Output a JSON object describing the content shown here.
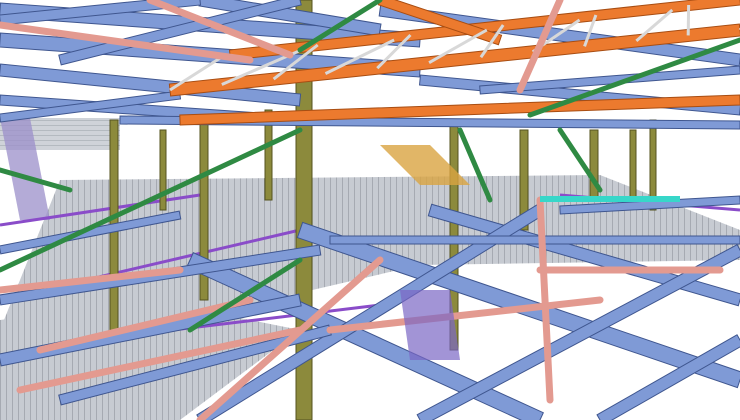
{
  "scene": {
    "subject": "structural-steel-framework-3d-model",
    "colors": {
      "background": "#ffffff",
      "beam_blue": "#7f9ad6",
      "beam_blue_dark": "#3f568f",
      "truss_orange": "#ec7a2e",
      "truss_orange_dark": "#a84d12",
      "column_olive": "#8c8a3c",
      "column_olive_dark": "#55531f",
      "brace_pink": "#e39a90",
      "brace_green": "#2f8a43",
      "edge_purple": "#8a4cc9",
      "deck_grey": "#c7cbd2",
      "deck_line": "#8f949c",
      "cyan_accent": "#37d7c9"
    }
  }
}
